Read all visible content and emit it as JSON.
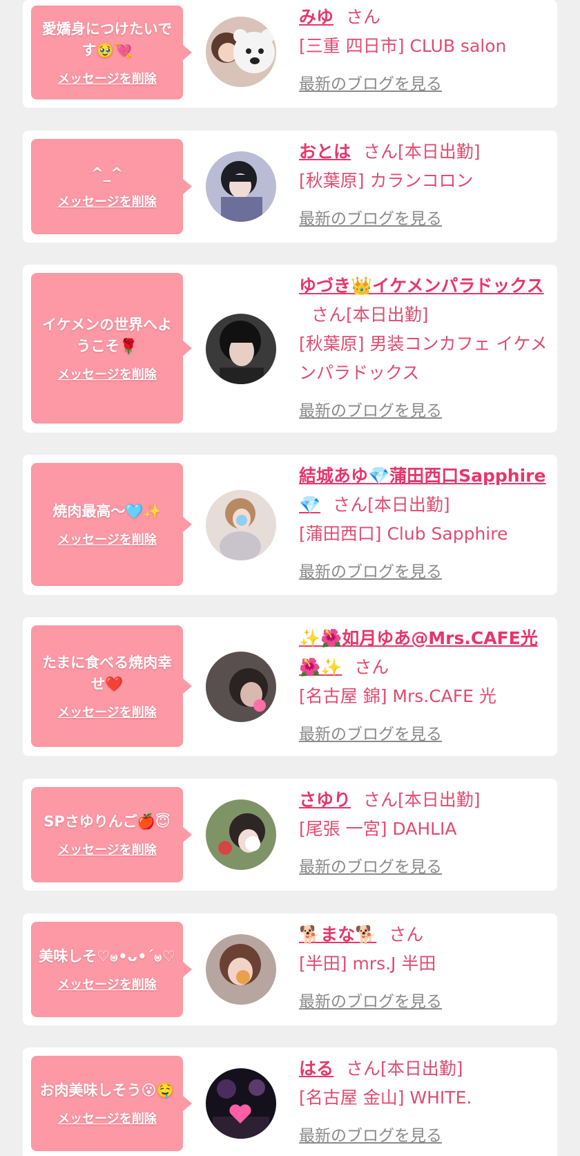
{
  "entries": [
    {
      "message": "愛嬌身につけたいです🥹💘",
      "delete_label": "メッセージを削除",
      "name": "みゆ",
      "honorific": "さん",
      "shop": "[三重 四日市] CLUB salon",
      "blog_label": "最新のブログを見る",
      "avatar_icon": "avatar-photo"
    },
    {
      "message": "^_^",
      "delete_label": "メッセージを削除",
      "name": "おとは",
      "honorific": "さん[本日出勤]",
      "shop": "[秋葉原] カランコロン",
      "blog_label": "最新のブログを見る",
      "avatar_icon": "avatar-photo"
    },
    {
      "message": "イケメンの世界へようこそ🌹",
      "delete_label": "メッセージを削除",
      "name": "ゆづき👑イケメンパラドックス",
      "honorific": "さん[本日出勤]",
      "shop": "[秋葉原] 男装コンカフェ イケメンパラドックス",
      "blog_label": "最新のブログを見る",
      "avatar_icon": "avatar-photo"
    },
    {
      "message": "焼肉最高〜🩵✨",
      "delete_label": "メッセージを削除",
      "name": "結城あゆ💎蒲田西口Sapphire💎",
      "honorific": "さん[本日出勤]",
      "shop": "[蒲田西口] Club Sapphire",
      "blog_label": "最新のブログを見る",
      "avatar_icon": "avatar-photo"
    },
    {
      "message": "たまに食べる焼肉幸せ❤️",
      "delete_label": "メッセージを削除",
      "name": "✨🌺如月ゆあ@Mrs.CAFE光🌺✨",
      "honorific": "さん",
      "shop": "[名古屋 錦] Mrs.CAFE 光",
      "blog_label": "最新のブログを見る",
      "avatar_icon": "avatar-photo"
    },
    {
      "message": "SPさゆりんご🍎😇",
      "delete_label": "メッセージを削除",
      "name": "さゆり",
      "honorific": "さん[本日出勤]",
      "shop": "[尾張 一宮] DAHLIA",
      "blog_label": "最新のブログを見る",
      "avatar_icon": "avatar-photo"
    },
    {
      "message": "美味しそ♡ၑ•ᴗ•´ၑ♡",
      "delete_label": "メッセージを削除",
      "name": "🐕まな🐕",
      "honorific": "さん",
      "shop": "[半田] mrs.J 半田",
      "blog_label": "最新のブログを見る",
      "avatar_icon": "avatar-photo"
    },
    {
      "message": "お肉美味しそう😮🤤",
      "delete_label": "メッセージを削除",
      "name": "はる",
      "honorific": "さん[本日出勤]",
      "shop": "[名古屋 金山] WHITE.",
      "blog_label": "最新のブログを見る",
      "avatar_icon": "avatar-photo"
    }
  ],
  "colors": {
    "bubble": "#fd98a5",
    "name": "#e8356a",
    "text": "#e14b70",
    "link_gray": "#8a8a8a",
    "background": "#efefef"
  }
}
